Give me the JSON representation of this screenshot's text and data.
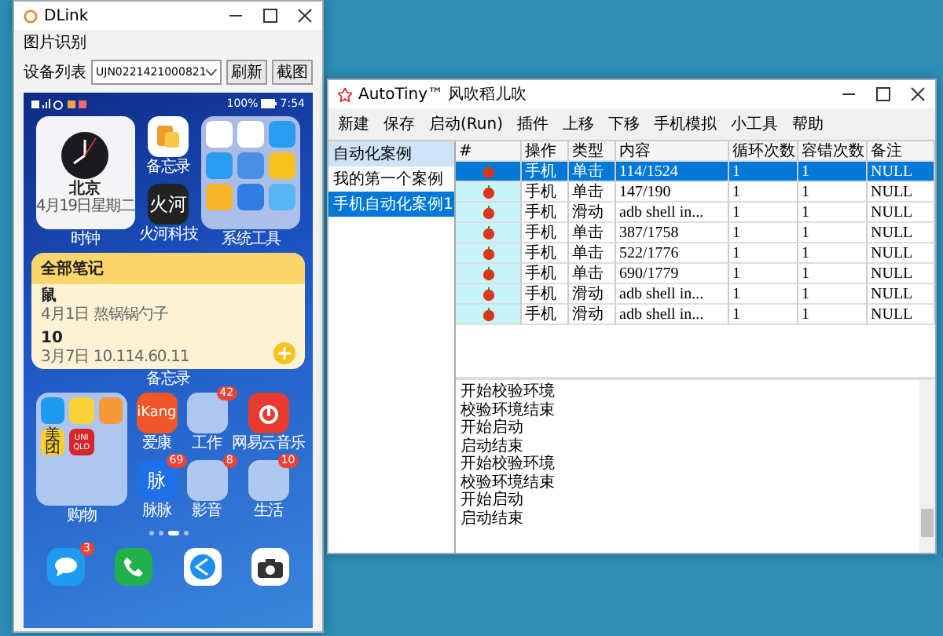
{
  "dlink": {
    "title": "DLink",
    "menu": [
      "图片识别"
    ],
    "device_label": "设备列表",
    "device_value": "UJN0221421000821",
    "buttons": [
      "刷新",
      "截图"
    ]
  },
  "phone": {
    "status_bar": {
      "battery": "100%",
      "time": "7:54"
    },
    "clock_widget": {
      "city": "北京",
      "date": "4月19日星期二",
      "label": "时钟"
    },
    "top_apps": [
      {
        "kind": "notes",
        "label": "备忘录"
      },
      {
        "kind": "wordmark",
        "label": "火河科技",
        "icon_text": "火河",
        "color": "#222222"
      }
    ],
    "tools_folder": {
      "label": "系统工具"
    },
    "notes_widget": {
      "title": "全部笔记",
      "label": "备忘录",
      "notes": [
        {
          "title": "鼠",
          "detail": "4月1日 熬锅锅勺子"
        },
        {
          "title": "10",
          "detail": "3月7日 10.114.60.11"
        }
      ]
    },
    "shopping_folder": {
      "label": "购物",
      "icon_texts": [
        "美团",
        "UNIQLO"
      ]
    },
    "apps": [
      {
        "kind": "wordmark",
        "label": "爱康",
        "icon_text": "iKang",
        "color": "#f0562a"
      },
      {
        "kind": "folder",
        "label": "工作",
        "badge": "42"
      },
      {
        "kind": "music",
        "label": "网易云音乐"
      },
      {
        "kind": "wordmark",
        "label": "脉脉",
        "icon_text": "脉",
        "badge": "69",
        "color": "#1f6fe6"
      },
      {
        "kind": "folder",
        "label": "影音",
        "badge": "8"
      },
      {
        "kind": "folder",
        "label": "生活",
        "badge": "10"
      }
    ],
    "page_dots": [
      {
        "selected": false
      },
      {
        "selected": false
      },
      {
        "selected": true
      },
      {
        "selected": false
      }
    ],
    "dock": [
      {
        "kind": "messages",
        "badge": "3"
      },
      {
        "kind": "phone"
      },
      {
        "kind": "browser"
      },
      {
        "kind": "camera"
      }
    ]
  },
  "autotiny": {
    "title": "AutoTiny™ 风吹稻儿吹",
    "menu": [
      "新建",
      "保存",
      "启动(Run)",
      "插件",
      "上移",
      "下移",
      "手机模拟",
      "小工具",
      "帮助"
    ],
    "cases": {
      "header": "自动化案例",
      "items": [
        {
          "label": "我的第一个案例",
          "selected": false
        },
        {
          "label": "手机自动化案例1",
          "selected": true
        }
      ]
    },
    "table": {
      "columns": [
        "#",
        "操作",
        "类型",
        "内容",
        "循环次数",
        "容错次数",
        "备注"
      ],
      "rows": [
        {
          "selected": true,
          "cells": [
            "",
            "手机",
            "单击",
            "114/1524",
            "1",
            "1",
            "NULL"
          ]
        },
        {
          "selected": false,
          "cells": [
            "",
            "手机",
            "单击",
            "147/190",
            "1",
            "1",
            "NULL"
          ]
        },
        {
          "selected": false,
          "cells": [
            "",
            "手机",
            "滑动",
            "adb shell in...",
            "1",
            "1",
            "NULL"
          ]
        },
        {
          "selected": false,
          "cells": [
            "",
            "手机",
            "单击",
            "387/1758",
            "1",
            "1",
            "NULL"
          ]
        },
        {
          "selected": false,
          "cells": [
            "",
            "手机",
            "单击",
            "522/1776",
            "1",
            "1",
            "NULL"
          ]
        },
        {
          "selected": false,
          "cells": [
            "",
            "手机",
            "单击",
            "690/1779",
            "1",
            "1",
            "NULL"
          ]
        },
        {
          "selected": false,
          "cells": [
            "",
            "手机",
            "滑动",
            "adb shell in...",
            "1",
            "1",
            "NULL"
          ]
        },
        {
          "selected": false,
          "cells": [
            "",
            "手机",
            "滑动",
            "adb shell in...",
            "1",
            "1",
            "NULL"
          ]
        }
      ]
    },
    "log": [
      "开始校验环境",
      "校验环境结束",
      "开始启动",
      "启动结束",
      "开始校验环境",
      "校验环境结束",
      "开始启动",
      "启动结束"
    ]
  }
}
